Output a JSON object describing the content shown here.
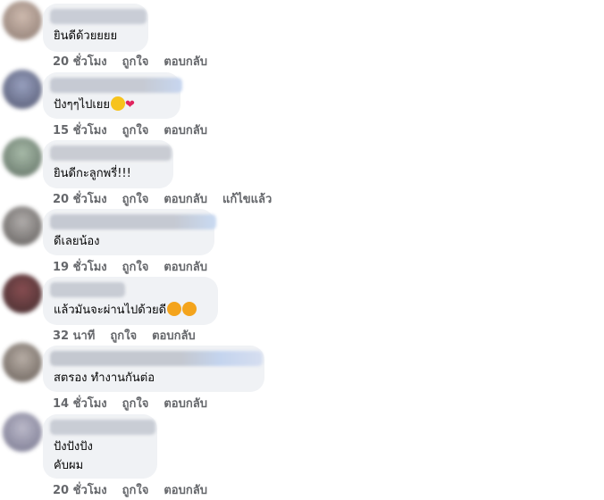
{
  "comments": [
    {
      "text": "ยินดีด้วยยยย",
      "time": "20 ชั่วโมง",
      "like": "ถูกใจ",
      "reply": "ตอบกลับ"
    },
    {
      "text": "ปังๆๆไปเยย",
      "time": "15 ชั่วโมง",
      "like": "ถูกใจ",
      "reply": "ตอบกลับ"
    },
    {
      "text": "ยินดีกะลูกพรี่!!!",
      "time": "20 ชั่วโมง",
      "like": "ถูกใจ",
      "reply": "ตอบกลับ",
      "edited": "แก้ไขแล้ว"
    },
    {
      "text": "ดีเลยน้อง",
      "time": "19 ชั่วโมง",
      "like": "ถูกใจ",
      "reply": "ตอบกลับ"
    },
    {
      "text": "แล้วมันจะผ่านไปด้วยดี",
      "time": "32 นาที",
      "like": "ถูกใจ",
      "reply": "ตอบกลับ"
    },
    {
      "text": "สตรอง ทำงานกันต่อ",
      "time": "14 ชั่วโมง",
      "like": "ถูกใจ",
      "reply": "ตอบกลับ"
    },
    {
      "text_line1": "ปังปังปัง",
      "text_line2": "คับผม",
      "time": "20 ชั่วโมง",
      "like": "ถูกใจ",
      "reply": "ตอบกลับ"
    }
  ],
  "colors": {
    "bubble": "#f0f2f5",
    "action_text": "#65676b",
    "body_text": "#050505"
  },
  "icons": {
    "emoji_face": "smiling-face-with-hearts-icon",
    "emoji_heart": "red-heart-icon"
  }
}
